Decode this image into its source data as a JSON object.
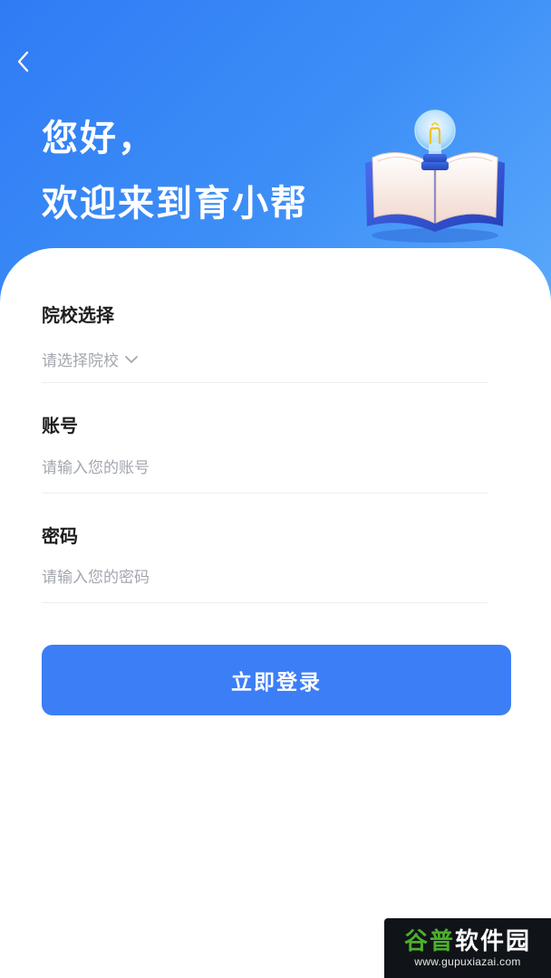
{
  "header": {
    "greeting_line1": "您好，",
    "greeting_line2": "欢迎来到育小帮"
  },
  "form": {
    "school": {
      "label": "院校选择",
      "placeholder": "请选择院校"
    },
    "account": {
      "label": "账号",
      "placeholder": "请输入您的账号"
    },
    "password": {
      "label": "密码",
      "placeholder": "请输入您的密码"
    },
    "submit_label": "立即登录"
  },
  "watermark": {
    "title_green": "谷普",
    "title_white": "软件园",
    "url": "www.gupuxiazai.com"
  },
  "colors": {
    "header_gradient_start": "#2f7bf5",
    "header_gradient_end": "#59a8fb",
    "primary_button": "#3c7ef6",
    "placeholder_text": "#a3a7ae",
    "label_text": "#1e1e1e"
  },
  "icons": {
    "back": "chevron-left-icon",
    "dropdown": "chevron-down-icon",
    "illustration": "book-lightbulb-illustration"
  }
}
